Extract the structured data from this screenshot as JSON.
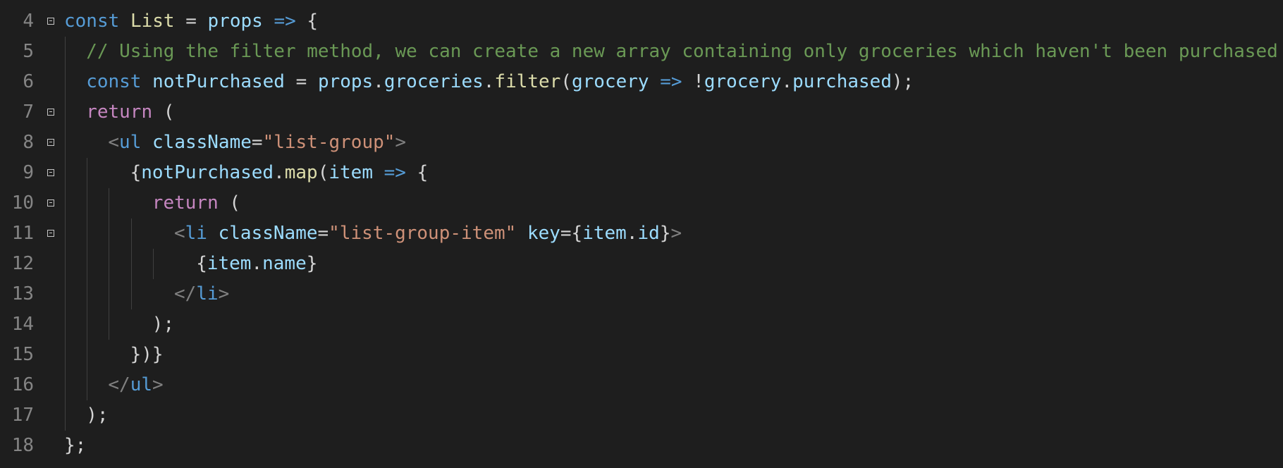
{
  "editor": {
    "lines": [
      {
        "num": "4",
        "fold": true,
        "indent": 0,
        "tokens": [
          {
            "t": "const",
            "c": "k"
          },
          {
            "t": " "
          },
          {
            "t": "List",
            "c": "f"
          },
          {
            "t": " = "
          },
          {
            "t": "props",
            "c": "v"
          },
          {
            "t": " "
          },
          {
            "t": "=>",
            "c": "k"
          },
          {
            "t": " {"
          }
        ]
      },
      {
        "num": "5",
        "fold": false,
        "indent": 1,
        "tokens": [
          {
            "t": "// Using the filter method, we can create a new array containing only groceries which haven't been purchased",
            "c": "cm"
          }
        ]
      },
      {
        "num": "6",
        "fold": false,
        "indent": 1,
        "tokens": [
          {
            "t": "const",
            "c": "k"
          },
          {
            "t": " "
          },
          {
            "t": "notPurchased",
            "c": "v"
          },
          {
            "t": " = "
          },
          {
            "t": "props",
            "c": "v"
          },
          {
            "t": "."
          },
          {
            "t": "groceries",
            "c": "v"
          },
          {
            "t": "."
          },
          {
            "t": "filter",
            "c": "f"
          },
          {
            "t": "("
          },
          {
            "t": "grocery",
            "c": "v"
          },
          {
            "t": " "
          },
          {
            "t": "=>",
            "c": "k"
          },
          {
            "t": " !"
          },
          {
            "t": "grocery",
            "c": "v"
          },
          {
            "t": "."
          },
          {
            "t": "purchased",
            "c": "v"
          },
          {
            "t": ");"
          }
        ]
      },
      {
        "num": "7",
        "fold": true,
        "indent": 1,
        "tokens": [
          {
            "t": "return",
            "c": "r"
          },
          {
            "t": " ("
          }
        ]
      },
      {
        "num": "8",
        "fold": true,
        "indent": 2,
        "tokens": [
          {
            "t": "<",
            "c": "t"
          },
          {
            "t": "ul",
            "c": "tn"
          },
          {
            "t": " "
          },
          {
            "t": "className",
            "c": "v"
          },
          {
            "t": "="
          },
          {
            "t": "\"list-group\"",
            "c": "s"
          },
          {
            "t": ">",
            "c": "t"
          }
        ]
      },
      {
        "num": "9",
        "fold": true,
        "indent": 3,
        "tokens": [
          {
            "t": "{"
          },
          {
            "t": "notPurchased",
            "c": "v"
          },
          {
            "t": "."
          },
          {
            "t": "map",
            "c": "f"
          },
          {
            "t": "("
          },
          {
            "t": "item",
            "c": "v"
          },
          {
            "t": " "
          },
          {
            "t": "=>",
            "c": "k"
          },
          {
            "t": " {"
          }
        ]
      },
      {
        "num": "10",
        "fold": true,
        "indent": 4,
        "tokens": [
          {
            "t": "return",
            "c": "r"
          },
          {
            "t": " ("
          }
        ]
      },
      {
        "num": "11",
        "fold": true,
        "indent": 5,
        "tokens": [
          {
            "t": "<",
            "c": "t"
          },
          {
            "t": "li",
            "c": "tn"
          },
          {
            "t": " "
          },
          {
            "t": "className",
            "c": "v"
          },
          {
            "t": "="
          },
          {
            "t": "\"list-group-item\"",
            "c": "s"
          },
          {
            "t": " "
          },
          {
            "t": "key",
            "c": "v"
          },
          {
            "t": "={"
          },
          {
            "t": "item",
            "c": "v"
          },
          {
            "t": "."
          },
          {
            "t": "id",
            "c": "v"
          },
          {
            "t": "}"
          },
          {
            "t": ">",
            "c": "t"
          }
        ]
      },
      {
        "num": "12",
        "fold": false,
        "indent": 6,
        "tokens": [
          {
            "t": "{"
          },
          {
            "t": "item",
            "c": "v"
          },
          {
            "t": "."
          },
          {
            "t": "name",
            "c": "v"
          },
          {
            "t": "}"
          }
        ]
      },
      {
        "num": "13",
        "fold": false,
        "indent": 5,
        "tokens": [
          {
            "t": "</",
            "c": "t"
          },
          {
            "t": "li",
            "c": "tn"
          },
          {
            "t": ">",
            "c": "t"
          }
        ]
      },
      {
        "num": "14",
        "fold": false,
        "indent": 4,
        "tokens": [
          {
            "t": ");"
          }
        ]
      },
      {
        "num": "15",
        "fold": false,
        "indent": 3,
        "tokens": [
          {
            "t": "})}"
          }
        ]
      },
      {
        "num": "16",
        "fold": false,
        "indent": 2,
        "tokens": [
          {
            "t": "</",
            "c": "t"
          },
          {
            "t": "ul",
            "c": "tn"
          },
          {
            "t": ">",
            "c": "t"
          }
        ]
      },
      {
        "num": "17",
        "fold": false,
        "indent": 1,
        "tokens": [
          {
            "t": ");"
          }
        ]
      },
      {
        "num": "18",
        "fold": false,
        "indent": 0,
        "tokens": [
          {
            "t": "};"
          }
        ]
      }
    ]
  },
  "colors": {
    "background": "#1e1e1e",
    "line_number": "#858585",
    "keyword": "#569cd6",
    "control": "#c586c0",
    "variable": "#9cdcfe",
    "function": "#dcdcaa",
    "string": "#ce9178",
    "comment": "#6a9955"
  }
}
